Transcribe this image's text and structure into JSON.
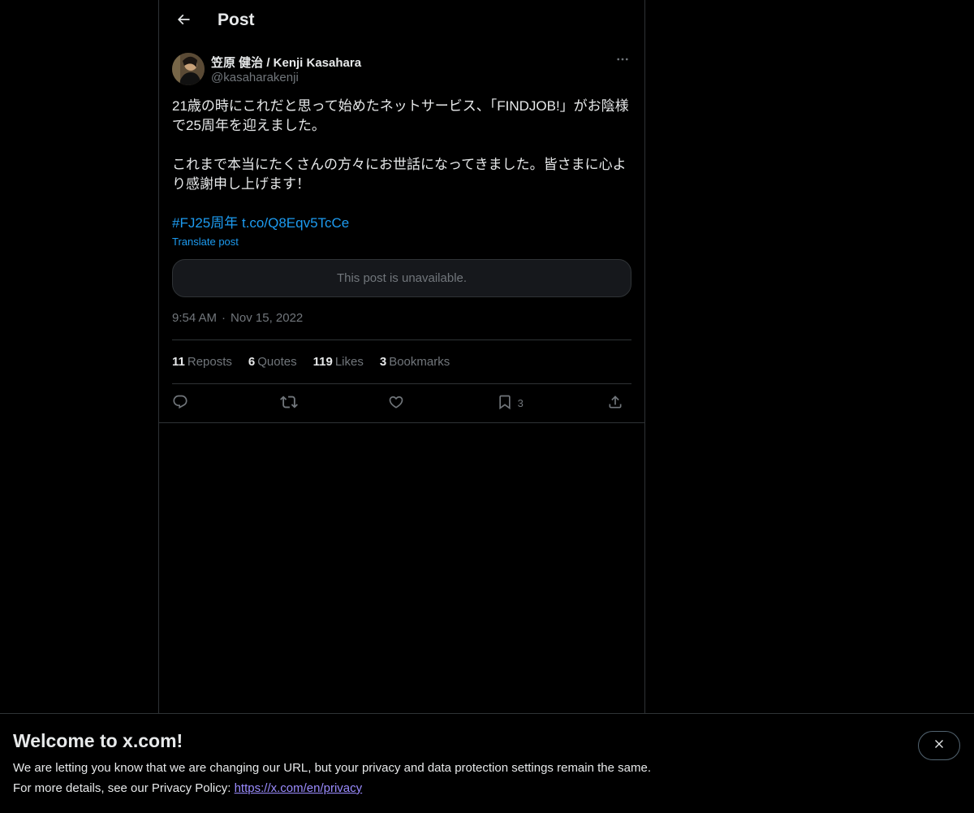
{
  "header": {
    "title": "Post",
    "back_icon": "arrow-left-icon"
  },
  "post": {
    "author_name": "笠原 健治 / Kenji Kasahara",
    "author_handle": "@kasaharakenji",
    "text": "21歳の時にこれだと思って始めたネットサービス、「FINDJOB!」がお陰様で25周年を迎えました。\n\nこれまで本当にたくさんの方々にお世話になってきました。皆さまに心より感謝申し上げます！\n\n",
    "hashtag": "#FJ25周年",
    "link": "t.co/Q8Eqv5TcCe",
    "translate_label": "Translate post",
    "unavailable_text": "This post is unavailable.",
    "time": "9:54 AM",
    "date": "Nov 15, 2022",
    "separator": "·"
  },
  "stats": {
    "reposts_count": "11",
    "reposts_label": "Reposts",
    "quotes_count": "6",
    "quotes_label": "Quotes",
    "likes_count": "119",
    "likes_label": "Likes",
    "bookmarks_count": "3",
    "bookmarks_label": "Bookmarks"
  },
  "actions": {
    "reply_icon": "reply-icon",
    "repost_icon": "repost-icon",
    "like_icon": "heart-icon",
    "bookmark_icon": "bookmark-icon",
    "bookmark_count": "3",
    "share_icon": "share-icon"
  },
  "banner": {
    "title": "Welcome to x.com!",
    "line1": "We are letting you know that we are changing our URL, but your privacy and data protection settings remain the same.",
    "line2_prefix": "For more details, see our Privacy Policy: ",
    "privacy_link": "https://x.com/en/privacy",
    "close_icon": "close-icon"
  },
  "colors": {
    "background": "#000000",
    "text": "#e7e9ea",
    "secondary_text": "#71767b",
    "link": "#1d9bf0",
    "border": "#2f3336"
  }
}
